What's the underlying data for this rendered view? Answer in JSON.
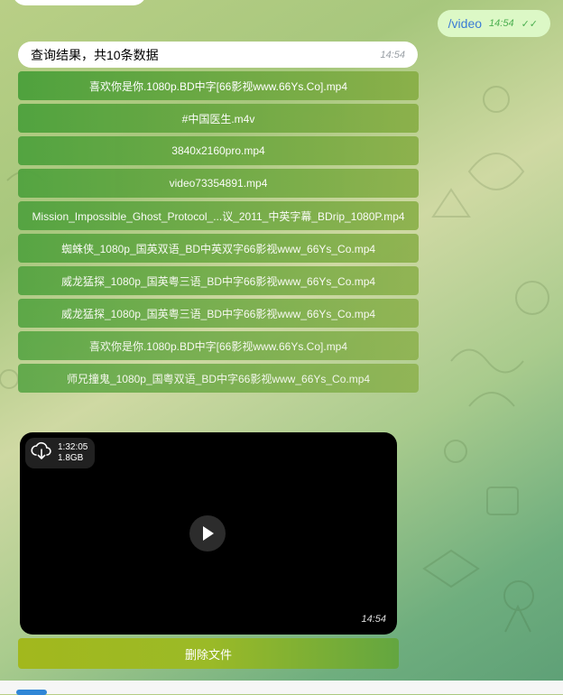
{
  "outgoing": {
    "text": "/video",
    "time": "14:54",
    "status_icon": "double-check-icon"
  },
  "result_msg": {
    "text": "查询结果，共10条数据",
    "time": "14:54"
  },
  "files": [
    "喜欢你是你.1080p.BD中字[66影视www.66Ys.Co].mp4",
    "#中国医生.m4v",
    "3840x2160pro.mp4",
    "video73354891.mp4",
    "Mission_Impossible_Ghost_Protocol_...议_2011_中英字幕_BDrip_1080P.mp4",
    "蜘蛛侠_1080p_国英双语_BD中英双字66影视www_66Ys_Co.mp4",
    "威龙猛探_1080p_国英粤三语_BD中字66影视www_66Ys_Co.mp4",
    "威龙猛探_1080p_国英粤三语_BD中字66影视www_66Ys_Co.mp4",
    "喜欢你是你.1080p.BD中字[66影视www.66Ys.Co].mp4",
    "师兄撞鬼_1080p_国粤双语_BD中字66影视www_66Ys_Co.mp4"
  ],
  "video": {
    "duration": "1:32:05",
    "size": "1.8GB",
    "time": "14:54"
  },
  "delete_label": "删除文件",
  "colors": {
    "button_top": "#4fa23e",
    "button_bottom": "#8bb04a",
    "accent": "#2f86d6"
  }
}
